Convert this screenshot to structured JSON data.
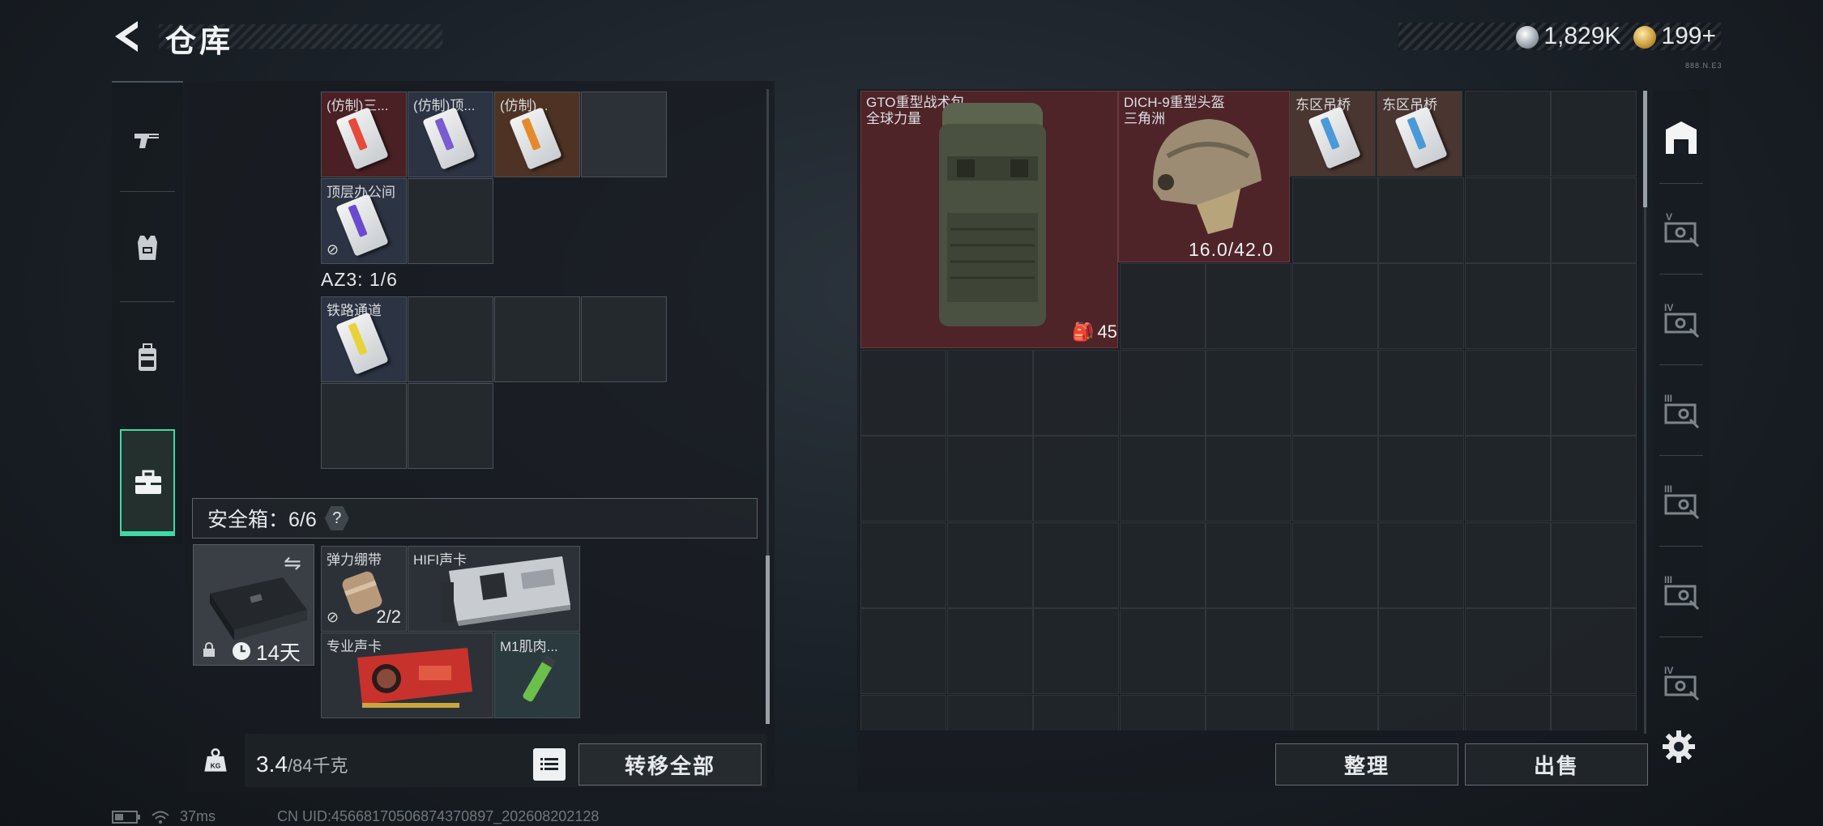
{
  "header": {
    "title": "仓库",
    "currency_silver": "1,829K",
    "currency_gold": "199",
    "gold_plus": "+",
    "corner_text": "888.N.E3"
  },
  "left_rail": {
    "tabs": [
      "weapons",
      "gear",
      "backpack",
      "toolbox"
    ],
    "active": "toolbox"
  },
  "key_cards_top": [
    {
      "label": "(仿制)三...",
      "color": "red",
      "stripe": "#e54a3a"
    },
    {
      "label": "(仿制)顶...",
      "color": "blue",
      "stripe": "#7a5bd0"
    },
    {
      "label": "(仿制)...",
      "color": "orange",
      "stripe": "#e58a2a"
    },
    {
      "label": "",
      "color": "grey"
    }
  ],
  "key_card_office": {
    "label": "顶层办公间",
    "stripe": "#6a4ad0"
  },
  "az3": {
    "label": "AZ3: 1/6"
  },
  "key_card_rail": {
    "label": "铁路通道",
    "stripe": "#e8d23a"
  },
  "safe_box": {
    "title": "安全箱：6/6",
    "help": "?",
    "days": "14天",
    "items": [
      {
        "label": "弹力绷带",
        "count": "2/2"
      },
      {
        "label": "HIFI声卡"
      },
      {
        "label": "专业声卡"
      },
      {
        "label": "M1肌肉..."
      }
    ]
  },
  "weight": {
    "value": "3.4",
    "unit": "/84千克",
    "fraction": 0.04
  },
  "buttons": {
    "transfer_all": "转移全部",
    "sort": "整理",
    "sell": "出售"
  },
  "stash_items": {
    "backpack": {
      "label_line1": "GTO重型战术包",
      "label_line2": "全球力量",
      "count": "45"
    },
    "helmet": {
      "label_line1": "DICH-9重型头盔",
      "label_line2": "三角洲",
      "durability": "16.0/42.0"
    },
    "card1": {
      "label": "东区吊桥"
    },
    "card2": {
      "label": "东区吊桥"
    }
  },
  "right_tabs": [
    "home-icon",
    "V",
    "IV",
    "III",
    "III",
    "III",
    "IV"
  ],
  "status": {
    "latency": "37ms",
    "uid": "CN UID:4566817050687437089​7_202608202128"
  }
}
